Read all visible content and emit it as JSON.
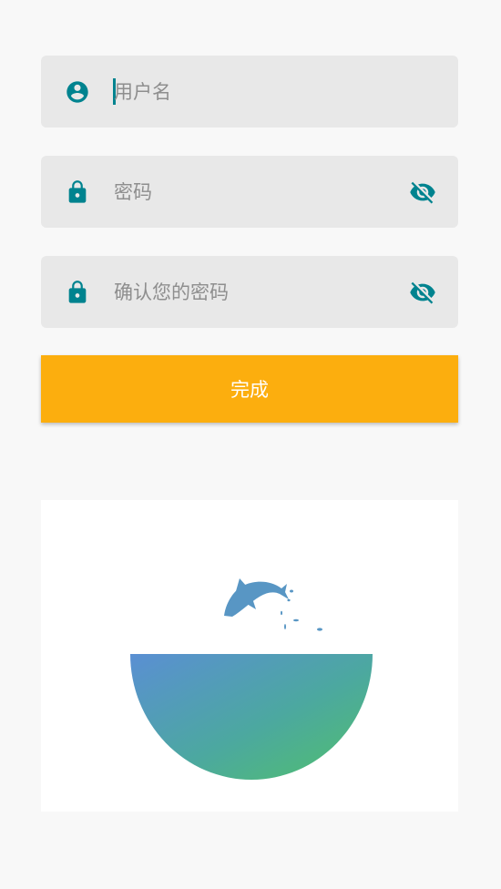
{
  "form": {
    "username": {
      "placeholder": "用户名",
      "value": "",
      "icon": "account-circle-icon"
    },
    "password": {
      "placeholder": "密码",
      "value": "",
      "icon": "lock-icon",
      "toggle_icon": "eye-off-icon"
    },
    "confirm_password": {
      "placeholder": "确认您的密码",
      "value": "",
      "icon": "lock-icon",
      "toggle_icon": "eye-off-icon"
    },
    "submit_label": "完成"
  },
  "colors": {
    "accent": "#00838f",
    "button": "#fcae0e",
    "field_bg": "#e8e8e8",
    "page_bg": "#f8f8f8"
  },
  "illustration": {
    "description_icon": "fish-bowl-illustration"
  }
}
